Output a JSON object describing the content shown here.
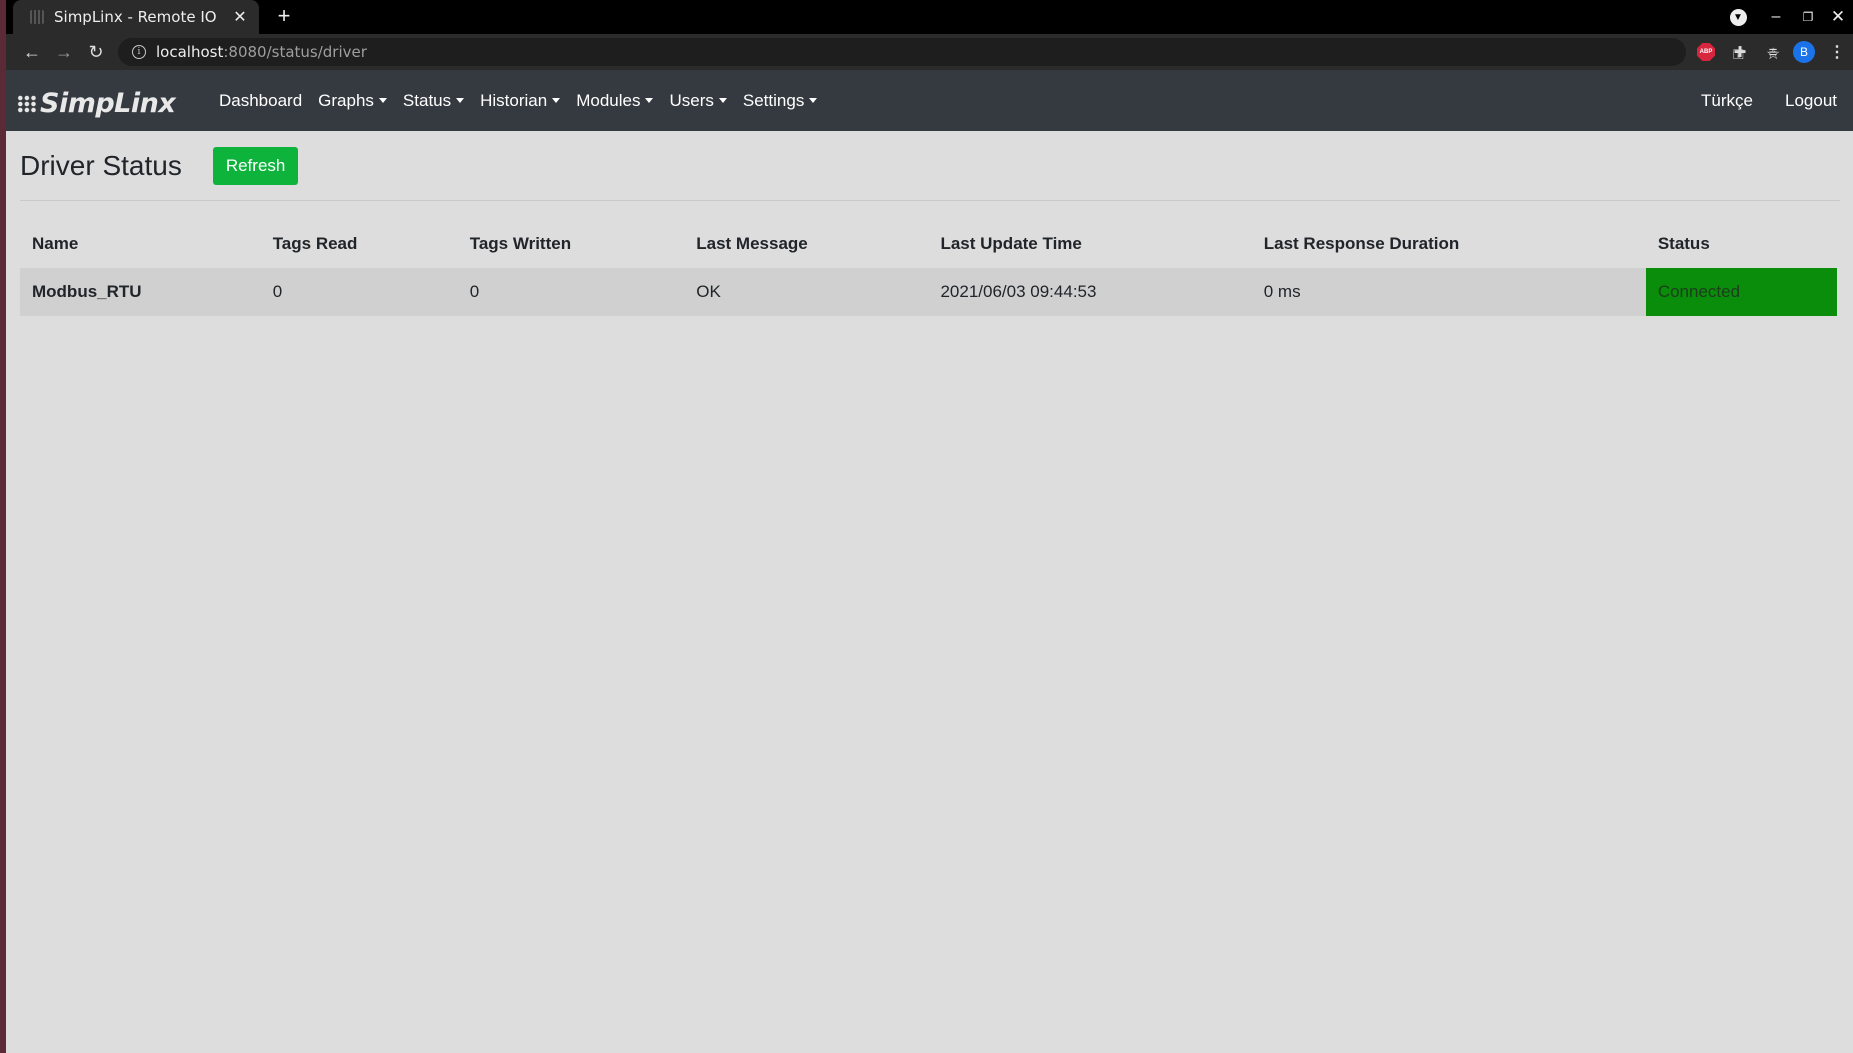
{
  "browser": {
    "tab_title": "SimpLinx - Remote IO",
    "url_host": "localhost",
    "url_rest": ":8080/status/driver",
    "profile_initial": "B",
    "abp_label": "ABP"
  },
  "nav": {
    "brand": "SimpLinx",
    "items": [
      {
        "label": "Dashboard",
        "dropdown": false
      },
      {
        "label": "Graphs",
        "dropdown": true
      },
      {
        "label": "Status",
        "dropdown": true
      },
      {
        "label": "Historian",
        "dropdown": true
      },
      {
        "label": "Modules",
        "dropdown": true
      },
      {
        "label": "Users",
        "dropdown": true
      },
      {
        "label": "Settings",
        "dropdown": true
      }
    ],
    "language": "Türkçe",
    "logout": "Logout"
  },
  "page": {
    "title": "Driver Status",
    "refresh_label": "Refresh"
  },
  "table": {
    "headers": [
      "Name",
      "Tags Read",
      "Tags Written",
      "Last Message",
      "Last Update Time",
      "Last Response Duration",
      "Status"
    ],
    "rows": [
      {
        "name": "Modbus_RTU",
        "tags_read": "0",
        "tags_written": "0",
        "last_message": "OK",
        "last_update_time": "2021/06/03 09:44:53",
        "last_response_duration": "0 ms",
        "status": "Connected"
      }
    ]
  },
  "colors": {
    "navbar": "#343a40",
    "page_bg": "#dddddd",
    "refresh_button": "#0eb33c",
    "status_connected": "#0a8d0a"
  }
}
